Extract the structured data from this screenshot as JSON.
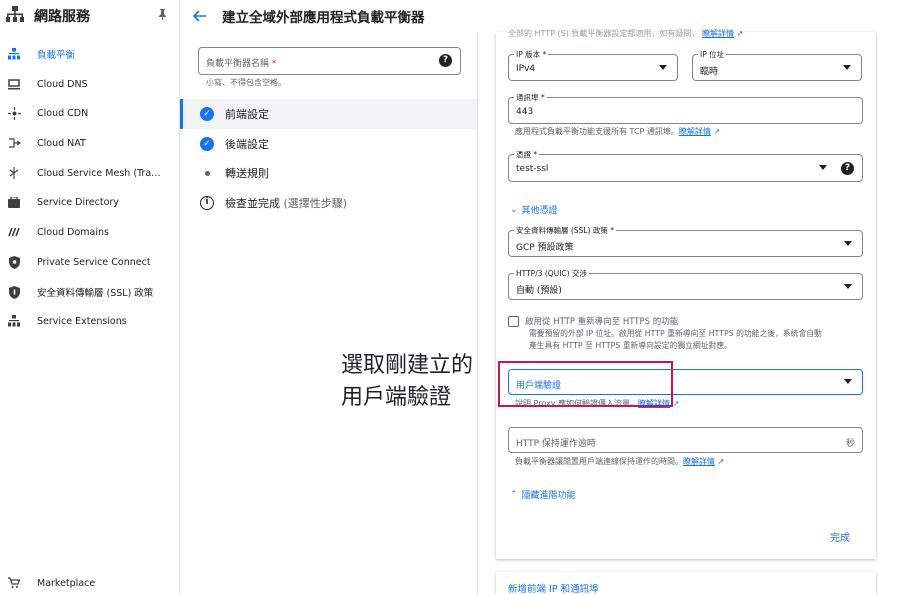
{
  "colors": {
    "accent": "#1a73e8",
    "annotation_box": "#c2185b",
    "required": "#d93025"
  },
  "sidebar": {
    "title": "網路服務",
    "items": [
      {
        "label": "負載平衡",
        "icon": "load-balancing-icon",
        "active": true
      },
      {
        "label": "Cloud DNS",
        "icon": "dns-icon"
      },
      {
        "label": "Cloud CDN",
        "icon": "cdn-icon"
      },
      {
        "label": "Cloud NAT",
        "icon": "nat-icon"
      },
      {
        "label": "Cloud Service Mesh (Traffic ...",
        "icon": "service-mesh-icon"
      },
      {
        "label": "Service Directory",
        "icon": "service-directory-icon"
      },
      {
        "label": "Cloud Domains",
        "icon": "domains-icon"
      },
      {
        "label": "Private Service Connect",
        "icon": "private-service-connect-icon"
      },
      {
        "label": "安全資料傳輸層 (SSL) 政策",
        "icon": "ssl-policy-icon"
      },
      {
        "label": "Service Extensions",
        "icon": "service-extensions-icon"
      }
    ],
    "marketplace": "Marketplace"
  },
  "header": {
    "title": "建立全域外部應用程式負載平衡器"
  },
  "steps": {
    "name_placeholder": "負載平衡器名稱",
    "name_required": "*",
    "name_hint": "小寫、不得包含空格。",
    "items": [
      {
        "label": "前端設定",
        "state": "done"
      },
      {
        "label": "後端設定",
        "state": "done"
      },
      {
        "label": "轉送規則",
        "state": "pending"
      },
      {
        "label": "檢查並完成",
        "optional": "(選擇性步驟)",
        "state": "info"
      }
    ]
  },
  "form": {
    "top_truncated": "全部的 HTTP (S) 負載平衡器設定都適用，如有疑問，",
    "top_link": "瞭解詳情",
    "ip_version": {
      "label": "IP 版本 *",
      "value": "IPv4"
    },
    "ip_address": {
      "label": "IP 位址",
      "value": "臨時"
    },
    "port": {
      "label": "通訊埠 *",
      "value": "443"
    },
    "port_help": "應用程式負載平衡功能支援所有 TCP 通訊埠。",
    "port_help_link": "瞭解詳情",
    "certificate": {
      "label": "憑證 *",
      "value": "test-ssl"
    },
    "more_certs": "其他憑證",
    "ssl_policy": {
      "label": "安全資料傳輸層 (SSL) 政策 *",
      "value": "GCP 預設政策"
    },
    "quic": {
      "label": "HTTP/3 (QUIC) 交涉",
      "value": "自動 (預設)"
    },
    "redirect_label": "啟用從 HTTP 重新導向至 HTTPS 的功能",
    "redirect_desc1": "需要預留的外部 IP 位址。啟用從 HTTP 重新導向至 HTTPS 的功能之後，系統會自動",
    "redirect_desc2": "產生具有 HTTP 至 HTTPS 重新導向設定的獨立網址對應。",
    "client_tls": {
      "placeholder": "用戶端驗證"
    },
    "client_tls_help": "說明 Proxy 應如何驗證傳入流量。",
    "client_tls_link": "瞭解詳情",
    "keepalive": {
      "placeholder": "HTTP 保持運作逾時",
      "suffix": "秒"
    },
    "keepalive_help": "負載平衡器讓閒置用戶端連線保持運作的時間。",
    "keepalive_link": "瞭解詳情",
    "hide_advanced": "隱藏進階功能",
    "done": "完成",
    "add_frontend": "新增前端 IP 和通訊埠"
  },
  "annotation": {
    "line1": "選取剛建立的",
    "line2": "用戶端驗證"
  }
}
